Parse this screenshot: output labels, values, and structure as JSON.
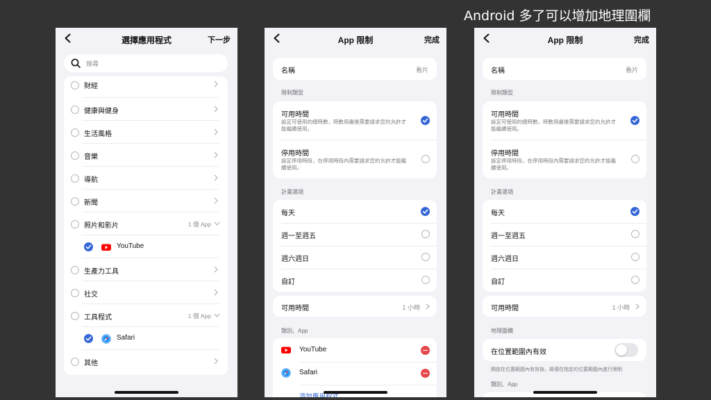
{
  "caption": "Android 多了可以增加地理圍欄",
  "icons": {
    "back": "chevron-left-icon",
    "search": "search-icon",
    "chevron": "chevron-right-icon",
    "check": "checkmark-circle-icon",
    "remove": "minus-circle-icon"
  },
  "colors": {
    "accent": "#3566d6",
    "remove": "#e5484d",
    "background": "#f2f2f7",
    "youtube_red": "#ff0000"
  },
  "phone1": {
    "title": "選擇應用程式",
    "next": "下一步",
    "search_placeholder": "搜尋",
    "categories": [
      {
        "label": "財經",
        "checked": false
      },
      {
        "label": "健康與健身",
        "checked": false
      },
      {
        "label": "生活風格",
        "checked": false
      },
      {
        "label": "音樂",
        "checked": false
      },
      {
        "label": "導航",
        "checked": false
      },
      {
        "label": "新聞",
        "checked": false
      },
      {
        "label": "照片和影片",
        "count": "1 個 App",
        "expanded": true,
        "checked": false
      },
      {
        "label": "YouTube",
        "app": true,
        "checked": true
      },
      {
        "label": "生產力工具",
        "checked": false
      },
      {
        "label": "社交",
        "checked": false
      },
      {
        "label": "工具程式",
        "count": "1 個 App",
        "expanded": true,
        "checked": false
      },
      {
        "label": "Safari",
        "app": true,
        "checked": true
      },
      {
        "label": "其他",
        "checked": false
      }
    ]
  },
  "limit": {
    "title": "App 限制",
    "done": "完成",
    "name_label": "名稱",
    "name_value": "看片",
    "type_header": "限制類型",
    "available": {
      "title": "可用時間",
      "desc": "設定可使用的總時數，時數用盡後需要請求您的允許才能繼續使用。",
      "selected": true
    },
    "downtime": {
      "title": "停用時間",
      "desc": "設定停用時段，在停用時段內需要請求您的允許才能繼續使用。",
      "selected": false
    },
    "schedule_header": "計畫選項",
    "schedule": [
      {
        "label": "每天",
        "selected": true
      },
      {
        "label": "週一至週五",
        "selected": false
      },
      {
        "label": "週六週日",
        "selected": false
      },
      {
        "label": "自訂",
        "selected": false
      }
    ],
    "time_label": "可用時間",
    "time_value": "1 小時",
    "apps_header": "類別、App",
    "apps": [
      "YouTube",
      "Safari"
    ],
    "add_app": "添加應用程式"
  },
  "geofence": {
    "header": "地理圍欄",
    "toggle_label": "在位置範圍內有效",
    "toggle_on": false,
    "note": "開啟在位置範圍內有效後，將僅在指定的位置範圍內進行限制",
    "apps_header": "類別、App"
  }
}
